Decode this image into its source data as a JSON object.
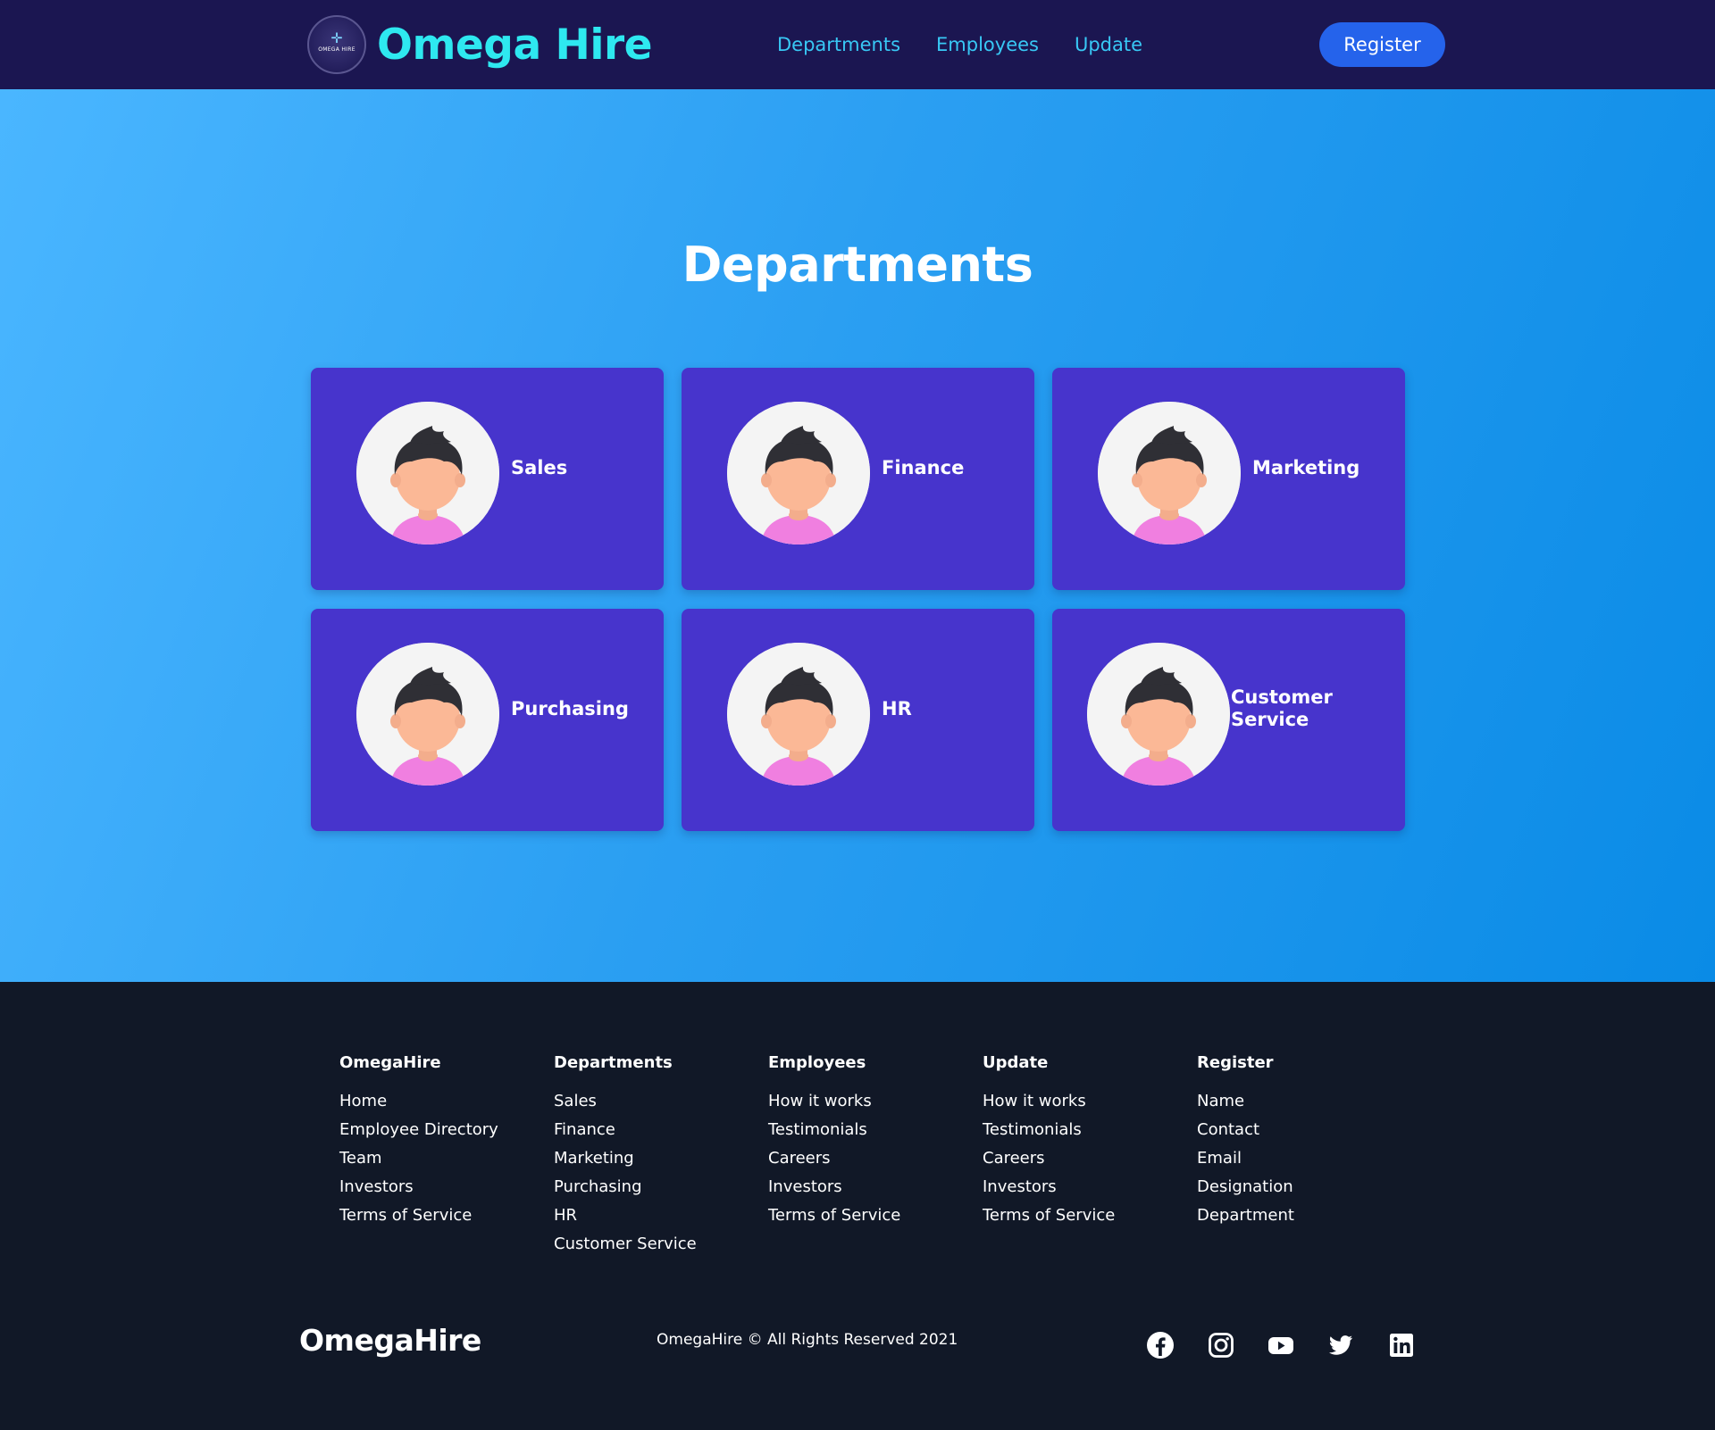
{
  "navbar": {
    "logo_text": "OMEGA HIRE",
    "brand": "Omega Hire",
    "links": [
      "Departments",
      "Employees",
      "Update"
    ],
    "register_label": "Register"
  },
  "main": {
    "title": "Departments",
    "cards": [
      {
        "label": "Sales"
      },
      {
        "label": "Finance"
      },
      {
        "label": "Marketing"
      },
      {
        "label": "Purchasing"
      },
      {
        "label": "HR"
      },
      {
        "label": "Customer Service"
      }
    ],
    "avatar_icon": "person-avatar-icon"
  },
  "footer": {
    "columns": [
      {
        "heading": "OmegaHire",
        "links": [
          "Home",
          "Employee Directory",
          "Team",
          "Investors",
          "Terms of Service"
        ]
      },
      {
        "heading": "Departments",
        "links": [
          "Sales",
          "Finance",
          "Marketing",
          "Purchasing",
          "HR",
          "Customer Service"
        ]
      },
      {
        "heading": "Employees",
        "links": [
          "How it works",
          "Testimonials",
          "Careers",
          "Investors",
          "Terms of Service"
        ]
      },
      {
        "heading": "Update",
        "links": [
          "How it works",
          "Testimonials",
          "Careers",
          "Investors",
          "Terms of Service"
        ]
      },
      {
        "heading": "Register",
        "links": [
          "Name",
          "Contact",
          "Email",
          "Designation",
          "Department"
        ]
      }
    ],
    "brand": "OmegaHire",
    "copyright": "OmegaHire © All Rights Reserved 2021",
    "social_icons": [
      "facebook-icon",
      "instagram-icon",
      "youtube-icon",
      "twitter-icon",
      "linkedin-icon"
    ]
  },
  "colors": {
    "navbar_bg": "#1b1651",
    "brand_cyan": "#2ee8f0",
    "nav_link": "#38c8f5",
    "register_btn": "#2563eb",
    "card_bg": "#4734cc",
    "footer_bg": "#111827"
  }
}
